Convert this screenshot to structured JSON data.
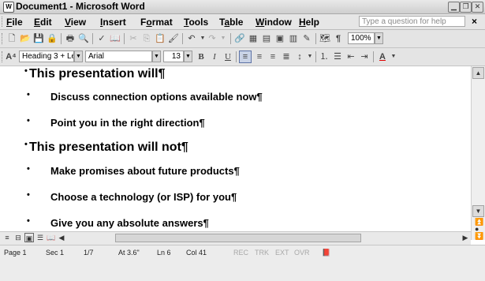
{
  "window": {
    "title": "Document1 - Microsoft Word",
    "app_icon_letter": "W"
  },
  "menubar": {
    "items": [
      {
        "pre": "",
        "key": "F",
        "post": "ile"
      },
      {
        "pre": "",
        "key": "E",
        "post": "dit"
      },
      {
        "pre": "",
        "key": "V",
        "post": "iew"
      },
      {
        "pre": "",
        "key": "I",
        "post": "nsert"
      },
      {
        "pre": "F",
        "key": "o",
        "post": "rmat"
      },
      {
        "pre": "",
        "key": "T",
        "post": "ools"
      },
      {
        "pre": "T",
        "key": "a",
        "post": "ble"
      },
      {
        "pre": "",
        "key": "W",
        "post": "indow"
      },
      {
        "pre": "",
        "key": "H",
        "post": "elp"
      }
    ],
    "ask_placeholder": "Type a question for help",
    "close_glyph": "×"
  },
  "standard_toolbar": {
    "zoom": "100%",
    "pilcrow": "¶"
  },
  "formatting_toolbar": {
    "style": "Heading 3 + Le",
    "font": "Arial",
    "size": "13",
    "bold": "B",
    "italic": "I",
    "underline": "U",
    "font_color": "A"
  },
  "document": {
    "sections": [
      {
        "heading": "This presentation will¶",
        "bullets": [
          "Discuss connection options available now¶",
          "Point you in the right direction¶"
        ]
      },
      {
        "heading": "This presentation will not¶",
        "bullets": [
          "Make promises about future products¶",
          "Choose a technology (or ISP) for you¶",
          "Give you any absolute answers¶"
        ]
      }
    ]
  },
  "statusbar": {
    "page": "Page  1",
    "section": "Sec  1",
    "pages": "1/7",
    "at": "At  3.6\"",
    "line": "Ln  6",
    "col": "Col  41",
    "rec": "REC",
    "trk": "TRK",
    "ext": "EXT",
    "ovr": "OVR",
    "lang_icon": "book-check"
  },
  "colors": {
    "active_button": "#c9d3e6",
    "dim_indicator": "#a8a8a8"
  }
}
